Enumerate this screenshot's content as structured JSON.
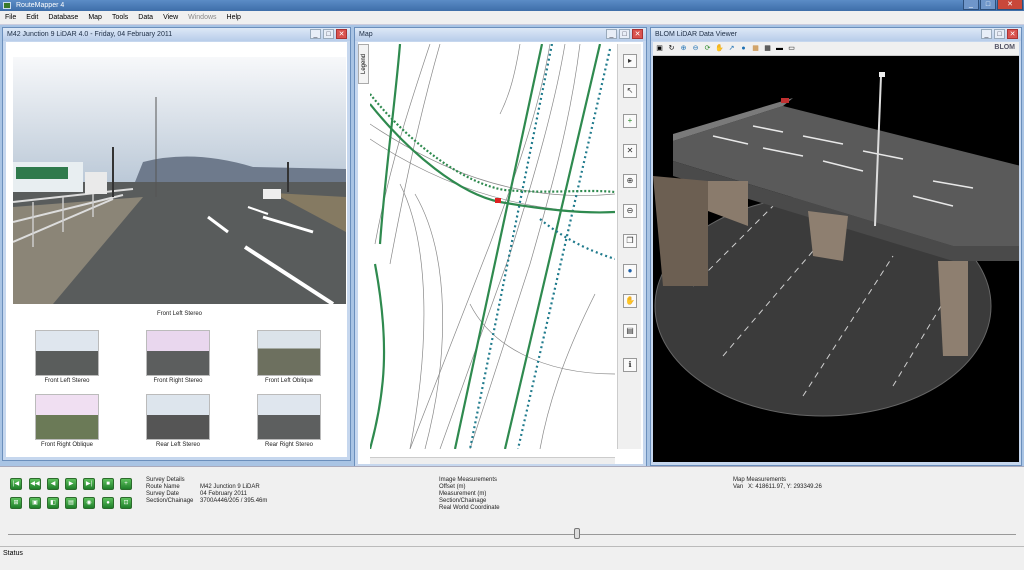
{
  "app": {
    "title": "RouteMapper 4"
  },
  "menu": [
    "File",
    "Edit",
    "Database",
    "Map",
    "Tools",
    "Data",
    "View",
    "Windows",
    "Help"
  ],
  "video_panel": {
    "title": "M42 Junction 9 LiDAR 4.0 - Friday, 04 February 2011",
    "main_caption": "Front Left Stereo",
    "thumbnails": [
      "Front Left Stereo",
      "Front Right Stereo",
      "Front Left Oblique",
      "Front Right Oblique",
      "Rear Left Stereo",
      "Rear Right Stereo"
    ]
  },
  "map_panel": {
    "title": "Map",
    "legend_tab": "Legend"
  },
  "lidar_panel": {
    "title": "BLOM LiDAR Data Viewer",
    "logo": "BLOM"
  },
  "survey": {
    "heading": "Survey Details",
    "rows": [
      {
        "label": "Route Name",
        "value": "M42 Junction 9 LiDAR"
      },
      {
        "label": "Survey Date",
        "value": "04 February 2011"
      },
      {
        "label": "Section/Chainage",
        "value": "3700A446/205 / 395.46m"
      }
    ]
  },
  "image_measurements": {
    "heading": "Image Measurements",
    "rows": [
      "Offset (m)",
      "Measurement (m)",
      "Section/Chainage",
      "Real World Coordinate"
    ]
  },
  "map_measurements": {
    "heading": "Map Measurements",
    "van_label": "Van",
    "van_value": "X: 418611.97, Y: 293349.26"
  },
  "status": "Status"
}
